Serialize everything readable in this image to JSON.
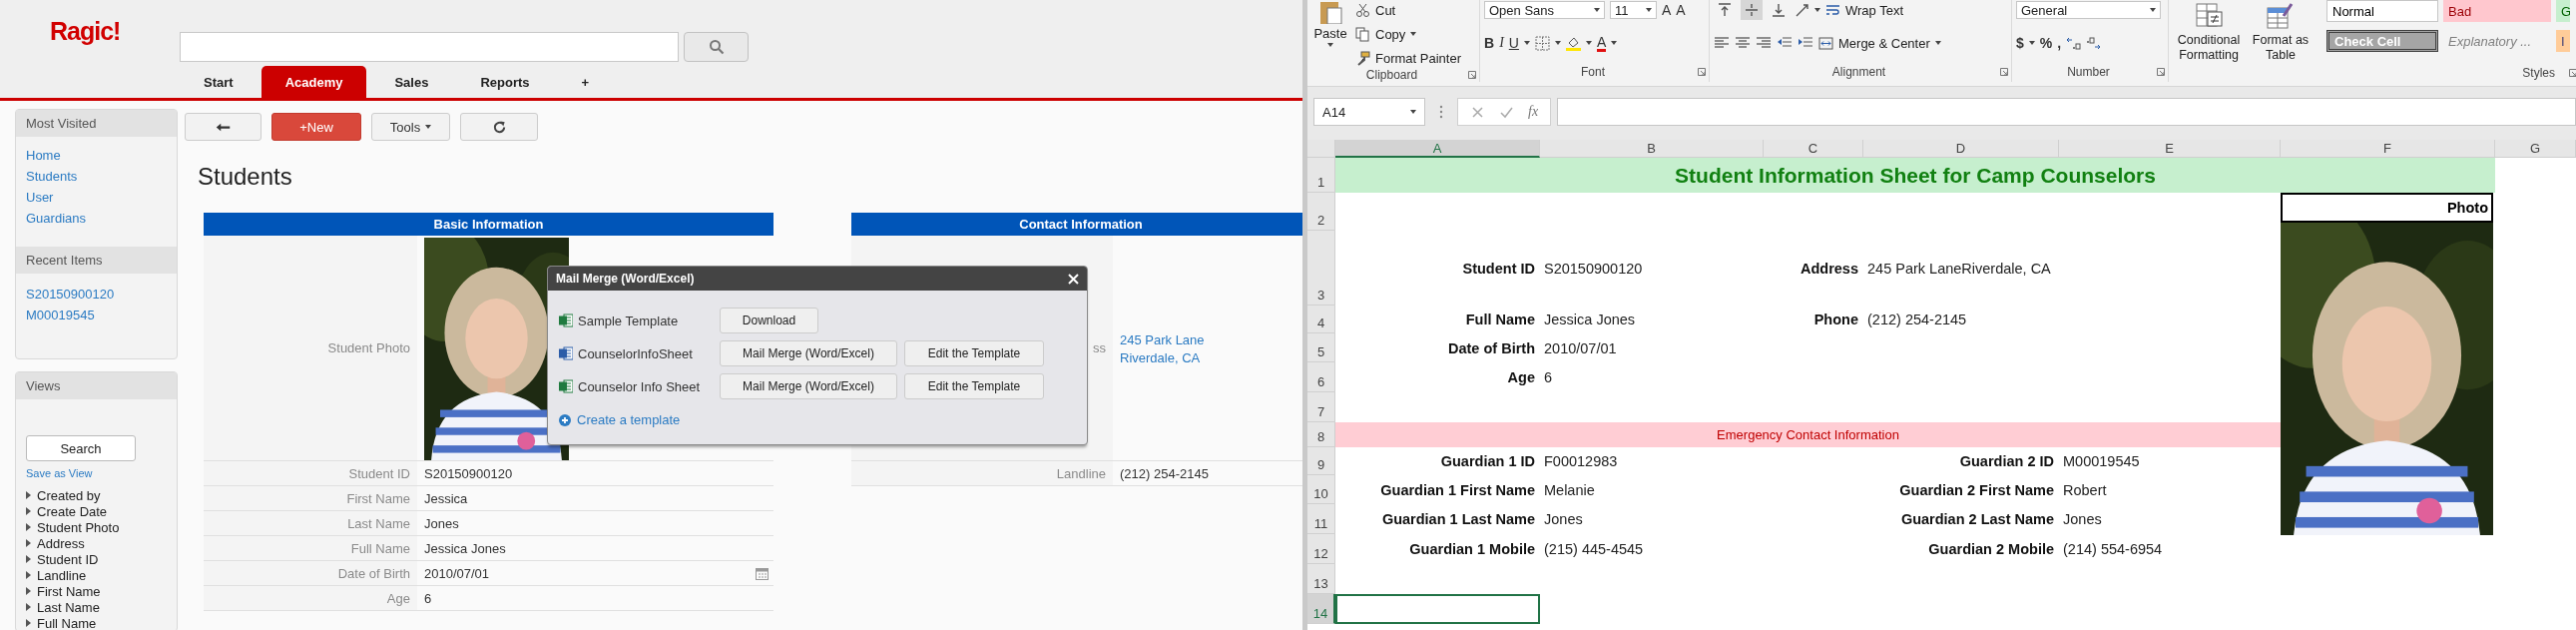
{
  "ragic": {
    "logo": "Ragic!",
    "tabs": [
      {
        "label": "Start",
        "selected": false
      },
      {
        "label": "Academy",
        "selected": true
      },
      {
        "label": "Sales",
        "selected": false
      },
      {
        "label": "Reports",
        "selected": false
      },
      {
        "label": "+",
        "selected": false
      }
    ],
    "sidebar": {
      "most_visited": {
        "title": "Most Visited",
        "links": [
          "Home",
          "Students",
          "User",
          "Guardians"
        ]
      },
      "recent_items": {
        "title": "Recent Items",
        "links": [
          "S20150900120",
          "M00019545"
        ]
      },
      "views": {
        "title": "Views",
        "search_button": "Search",
        "save_link": "Save as View",
        "fields": [
          "Created by",
          "Create Date",
          "Student Photo",
          "Address",
          "Student ID",
          "Landline",
          "First Name",
          "Last Name",
          "Full Name"
        ]
      }
    },
    "toolbar": {
      "new_button": "+New",
      "tools_button": "Tools"
    },
    "page_title": "Students",
    "sections": [
      {
        "title": "Basic Information",
        "fields": [
          {
            "label": "Student Photo"
          },
          {
            "kind": "text",
            "label": "Student ID",
            "value": "S20150900120"
          },
          {
            "kind": "text",
            "label": "First Name",
            "value": "Jessica"
          },
          {
            "kind": "text",
            "label": "Last Name",
            "value": "Jones"
          },
          {
            "kind": "text",
            "label": "Full Name",
            "value": "Jessica Jones"
          },
          {
            "kind": "date",
            "label": "Date of Birth",
            "value": "2010/07/01"
          },
          {
            "kind": "text",
            "label": "Age",
            "value": "6"
          }
        ]
      },
      {
        "title": "Contact Information",
        "fields": [
          {
            "kind": "link",
            "label": "ss",
            "lines": [
              "245 Park Lane",
              "Riverdale, CA"
            ]
          },
          {
            "kind": "text",
            "label": "Landline",
            "value": "(212) 254-2145"
          }
        ]
      }
    ],
    "dialog": {
      "title": "Mail Merge (Word/Excel)",
      "templates": [
        {
          "kind": "excel",
          "name": "Sample Template",
          "buttons": [
            "Download"
          ]
        },
        {
          "kind": "word",
          "name": "CounselorInfoSheet",
          "buttons": [
            "Mail Merge (Word/Excel)",
            "Edit the Template"
          ]
        },
        {
          "kind": "excel",
          "name": "Counselor Info Sheet",
          "buttons": [
            "Mail Merge (Word/Excel)",
            "Edit the Template"
          ]
        }
      ],
      "create_link": "Create a template"
    }
  },
  "excel": {
    "ribbon": {
      "paste": "Paste",
      "cut": "Cut",
      "copy": "Copy",
      "format_painter": "Format Painter",
      "font_name": "Open Sans",
      "font_size": "11",
      "grow_font": "A",
      "shrink_font": "A",
      "bold": "B",
      "italic": "I",
      "underline": "U",
      "font_color": "A",
      "vertical_align": [
        {
          "kind": "top",
          "selected": false
        },
        {
          "kind": "middle",
          "selected": true
        },
        {
          "kind": "bottom",
          "selected": false
        }
      ],
      "wrap_text": "Wrap Text",
      "merge_center": "Merge & Center",
      "number_format": "General",
      "currency": "$",
      "percent": "%",
      "comma": ",",
      "conditional_formatting": "Conditional Formatting",
      "format_as_table": "Format as Table",
      "cell_styles": [
        {
          "kind": "normal",
          "label": "Normal"
        },
        {
          "kind": "bad",
          "label": "Bad"
        },
        {
          "kind": "good",
          "label": "G"
        },
        {
          "kind": "check",
          "label": "Check Cell"
        },
        {
          "kind": "explanatory",
          "label": "Explanatory ..."
        },
        {
          "kind": "input",
          "label": "I"
        }
      ],
      "group_labels": [
        "Clipboard",
        "Font",
        "Alignment",
        "Number",
        "Styles"
      ]
    },
    "formula_bar": {
      "name_box": "A14",
      "function_label": "fx"
    },
    "columns": [
      {
        "label": "A",
        "selected": true
      },
      {
        "label": "B",
        "selected": false
      },
      {
        "label": "C",
        "selected": false
      },
      {
        "label": "D",
        "selected": false
      },
      {
        "label": "E",
        "selected": false
      },
      {
        "label": "F",
        "selected": false
      },
      {
        "label": "G",
        "selected": false
      }
    ],
    "photo_label": "Photo",
    "sheet_rows": [
      {
        "number": "1",
        "kind": "title",
        "selected": false,
        "text": "Student Information Sheet for Camp Counselors"
      },
      {
        "number": "2",
        "kind": "blank",
        "selected": false
      },
      {
        "number": "3",
        "kind": "pairs",
        "selected": false,
        "pairs": [
          {
            "label": "Student ID",
            "value": "S20150900120"
          },
          {
            "label": "Address",
            "value": "245 Park LaneRiverdale, CA"
          }
        ]
      },
      {
        "number": "4",
        "kind": "pairs",
        "selected": false,
        "pairs": [
          {
            "label": "Full Name",
            "value": "Jessica Jones"
          },
          {
            "label": "Phone",
            "value": "(212) 254-2145"
          }
        ]
      },
      {
        "number": "5",
        "kind": "pairs",
        "selected": false,
        "pairs": [
          {
            "label": "Date of Birth",
            "value": "2010/07/01"
          }
        ]
      },
      {
        "number": "6",
        "kind": "pairs",
        "selected": false,
        "pairs": [
          {
            "label": "Age",
            "value": "6"
          }
        ]
      },
      {
        "number": "7",
        "kind": "blank",
        "selected": false
      },
      {
        "number": "8",
        "kind": "band",
        "selected": false,
        "text": "Emergency Contact Information"
      },
      {
        "number": "9",
        "kind": "guardians",
        "selected": false,
        "pairs": [
          {
            "label": "Guardian 1 ID",
            "value": "F00012983"
          },
          {
            "label": "Guardian 2 ID",
            "value": "M00019545"
          }
        ]
      },
      {
        "number": "10",
        "kind": "guardians",
        "selected": false,
        "pairs": [
          {
            "label": "Guardian 1 First Name",
            "value": "Melanie"
          },
          {
            "label": "Guardian 2 First Name",
            "value": "Robert"
          }
        ]
      },
      {
        "number": "11",
        "kind": "guardians",
        "selected": false,
        "pairs": [
          {
            "label": "Guardian 1 Last Name",
            "value": "Jones"
          },
          {
            "label": "Guardian 2 Last Name",
            "value": "Jones"
          }
        ]
      },
      {
        "number": "12",
        "kind": "guardians",
        "selected": false,
        "pairs": [
          {
            "label": "Guardian 1 Mobile",
            "value": "(215) 445-4545"
          },
          {
            "label": "Guardian 2 Mobile",
            "value": "(214) 554-6954"
          }
        ]
      },
      {
        "number": "13",
        "kind": "blank",
        "selected": false
      },
      {
        "number": "14",
        "kind": "blank",
        "selected": true
      }
    ]
  }
}
